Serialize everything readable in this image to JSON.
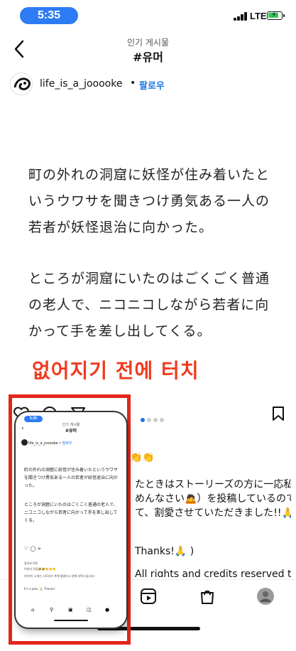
{
  "status_bar": {
    "time": "5:35",
    "network": "LTE"
  },
  "header": {
    "subtitle": "인기 게시물",
    "title": "#유머"
  },
  "post": {
    "username": "life_is_a_jooooke",
    "separator": "•",
    "follow_label": "팔로우",
    "image_text": {
      "paragraph1": "町の外れの洞窟に妖怪が住み着いたというウワサを聞きつけ勇気ある一人の若者が妖怪退治に向かった。",
      "paragraph2": "ところが洞窟にいたのはごくごく普通の老人で、ニコニコしながら若者に向かって手を差し出してくる。"
    },
    "overlay_caption": "없어지기 전에 터치",
    "carousel": {
      "total": 4,
      "active": 0
    },
    "caption_fragments": {
      "line1": "👏👏",
      "line2": "たときはストーリーズの方に一応私な",
      "line3": "めんなさい🙇）を投稿しているのです",
      "line4": "て、割愛させていただきました!!🙏",
      "line5": "Thanks!🙏 )",
      "line6": "All rights and credits reserved to"
    }
  },
  "mini_preview": {
    "time": "5:35",
    "subtitle": "인기 게시물",
    "title": "#유머",
    "username": "life_is_a_jooooke",
    "follow": "팔로우",
    "paragraph1": "町の外れの洞窟に妖怪が住み着いたというウワサを聞きつけ勇気ある一人の若者が妖怪退治に向かった。",
    "paragraph2": "ところが洞窟にいたのはごくごく普通の老人で、ニコニコしながら若者に向かって手を差し出してくる。",
    "likes": "좋아요 0개",
    "caption1": "이야기 모음🤣🤣👏👏👏",
    "caption2": "(이야기 소개는 스토리즈 쪽에 올렸으니 양해 부탁드립니다)",
    "caption3": "It's a joke. 🙏 Thanks!"
  },
  "colors": {
    "accent": "#1b74e4",
    "highlight_red": "#e2261a",
    "overlay_text": "#f03a1f",
    "time_pill": "#2d7cf6"
  },
  "icons": [
    "back-icon",
    "heart-icon",
    "comment-icon",
    "share-icon",
    "bookmark-icon",
    "reels-icon",
    "shop-icon",
    "profile-icon"
  ]
}
